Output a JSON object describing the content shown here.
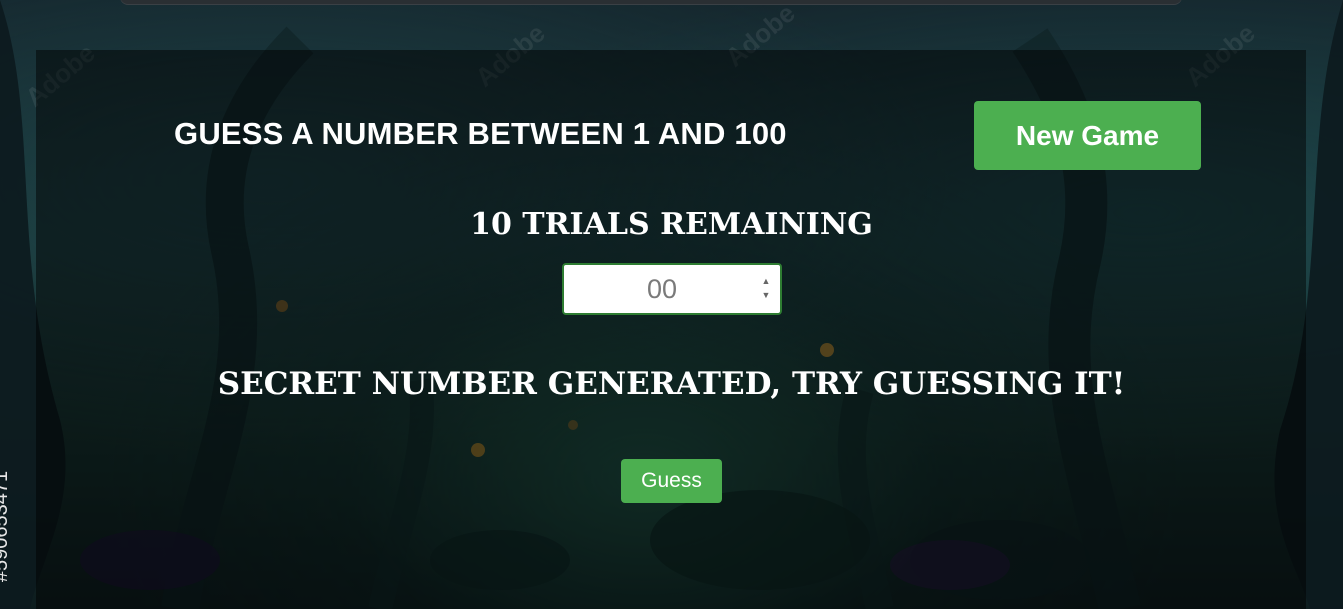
{
  "game": {
    "title": "GUESS A NUMBER BETWEEN 1 AND 100",
    "new_game_label": "New Game",
    "trials_text": "10 TRIALS REMAINING",
    "input_placeholder": "00",
    "message": "SECRET NUMBER GENERATED, TRY GUESSING IT!",
    "guess_label": "Guess"
  },
  "background": {
    "stock_id": "#590653471",
    "watermark_text": "Adobe Stock"
  },
  "colors": {
    "button_green": "#4caf50",
    "input_border": "#2e7d32",
    "text": "#ffffff"
  }
}
